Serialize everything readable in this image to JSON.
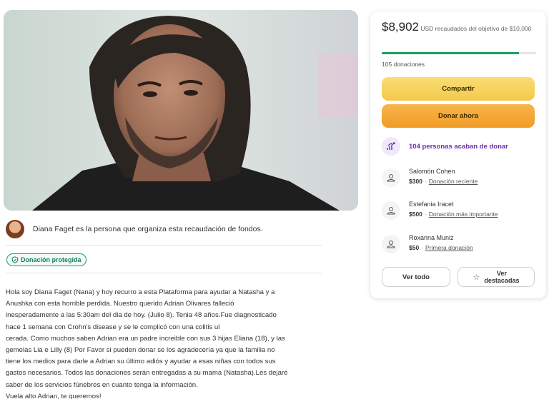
{
  "organizer": {
    "text": "Diana Faget es la persona que organiza esta recaudación de fondos."
  },
  "badge": {
    "label": "Donación protegida",
    "icon": "shield-check-icon"
  },
  "story": {
    "lines": [
      "Hola soy Diana Faget (Nana) y hoy recurro a esta Plataforma para ayudar a Natasha y a",
      "Anushka con esta horrible perdida. Nuestro querido Adrian Olivares falleció",
      "inesperadamente a las 5:30am del dia de hoy. (Julio 8). Tenia 48 años.Fue diagnosticado",
      "hace 1 semana con Crohn's disease y se le complicó con una colitis ul",
      "cerada. Como muchos saben Adrian era un padre increible con sus 3 hijas Eliana (18), y las",
      "gemelas Lia e Lilly (8) Por Favor si pueden donar se los agradecería ya que la familia no",
      "tiene los medios para darle a Adrian su último adiós y ayudar a esas niñas con todos sus",
      "gastos necesarios. Todos las donaciones serán entregadas a su mama (Natasha).Les dejaré",
      "saber de los servicios fúnebres en cuanto tenga la información.",
      "Vuela alto Adrian, te queremos!"
    ]
  },
  "card": {
    "amount": "$8,902",
    "raised_text": "USD recaudados del objetivo de $10,000",
    "progress_fraction": 0.89,
    "donations_count": "105 donaciones",
    "share_label": "Compartir",
    "donate_label": "Donar ahora",
    "recent_text": "104 personas acaban de donar",
    "donors": [
      {
        "name": "Salomón Cohen",
        "amount": "$300",
        "tag": "Donación reciente"
      },
      {
        "name": "Estefania Iracet",
        "amount": "$500",
        "tag": "Donación más importante"
      },
      {
        "name": "Roxanna Muniz",
        "amount": "$50",
        "tag": "Primera donación"
      }
    ],
    "see_all_label": "Ver todo",
    "see_top_label": "Ver\ndestacadas",
    "colors": {
      "accent_green": "#1f9e63",
      "share_yellow": "#f3c94c",
      "donate_orange": "#f19b25",
      "purple": "#6a2ea6"
    }
  }
}
